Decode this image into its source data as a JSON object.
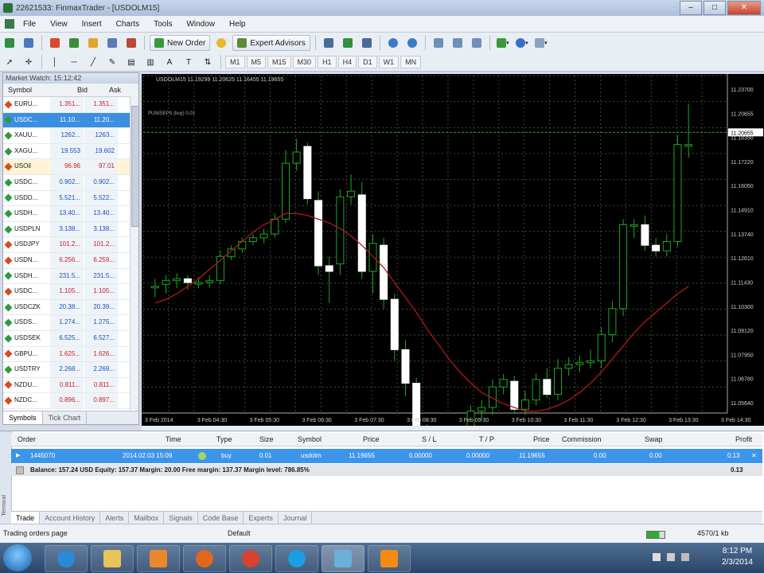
{
  "window": {
    "title": "22621533: FinmaxTrader - [USDOLM15]"
  },
  "menu": [
    "File",
    "View",
    "Insert",
    "Charts",
    "Tools",
    "Window",
    "Help"
  ],
  "toolbar": {
    "new_order": "New Order",
    "expert_advisors": "Expert Advisors",
    "timeframes": [
      "M1",
      "M5",
      "M15",
      "M30",
      "H1",
      "H4",
      "D1",
      "W1",
      "MN"
    ]
  },
  "market_watch": {
    "title": "Market Watch: 15:12:42",
    "headers": {
      "symbol": "Symbol",
      "bid": "Bid",
      "ask": "Ask"
    },
    "rows": [
      {
        "symbol": "EURU...",
        "bid": "1.351...",
        "ask": "1.351...",
        "dir": "down"
      },
      {
        "symbol": "USDC...",
        "bid": "11.10...",
        "ask": "11.20...",
        "dir": "up"
      },
      {
        "symbol": "XAUU...",
        "bid": "1262...",
        "ask": "1263...",
        "dir": "up"
      },
      {
        "symbol": "XAGU...",
        "bid": "19.553",
        "ask": "19.602",
        "dir": "up"
      },
      {
        "symbol": "USOil",
        "bid": "96.96",
        "ask": "97.01",
        "dir": "down"
      },
      {
        "symbol": "USDC...",
        "bid": "0.902...",
        "ask": "0.902...",
        "dir": "up"
      },
      {
        "symbol": "USDD...",
        "bid": "5.521...",
        "ask": "5.522...",
        "dir": "up"
      },
      {
        "symbol": "USDH...",
        "bid": "13.40...",
        "ask": "13.40...",
        "dir": "up"
      },
      {
        "symbol": "USDPLN",
        "bid": "3.138...",
        "ask": "3.138...",
        "dir": "up"
      },
      {
        "symbol": "USDJPY",
        "bid": "101.2...",
        "ask": "101.2...",
        "dir": "down"
      },
      {
        "symbol": "USDN...",
        "bid": "6.256...",
        "ask": "6.259...",
        "dir": "down"
      },
      {
        "symbol": "USDH...",
        "bid": "231.5...",
        "ask": "231.5...",
        "dir": "up"
      },
      {
        "symbol": "USDC...",
        "bid": "1.105...",
        "ask": "1.105...",
        "dir": "down"
      },
      {
        "symbol": "USDCZK",
        "bid": "20.38...",
        "ask": "20.39...",
        "dir": "up"
      },
      {
        "symbol": "USDS...",
        "bid": "1.274...",
        "ask": "1.275...",
        "dir": "up"
      },
      {
        "symbol": "USDSEK",
        "bid": "6.525...",
        "ask": "6.527...",
        "dir": "up"
      },
      {
        "symbol": "GBPU...",
        "bid": "1.625...",
        "ask": "1.626...",
        "dir": "down"
      },
      {
        "symbol": "USDTRY",
        "bid": "2.268...",
        "ask": "2.269...",
        "dir": "up"
      },
      {
        "symbol": "NZDU...",
        "bid": "0.811...",
        "ask": "0.811...",
        "dir": "down"
      },
      {
        "symbol": "NZDC...",
        "bid": "0.896...",
        "ask": "0.897...",
        "dir": "down"
      }
    ],
    "tabs": [
      "Symbols",
      "Tick Chart"
    ]
  },
  "chart": {
    "header": "USDOLM15 11.19299 11.20625 11.16455 11.19655",
    "line_label": "PUNISEPS (buy) 0.01",
    "price_labels": [
      "11.23700",
      "11.20655",
      "11.18350",
      "11.17220",
      "11.16050",
      "11.14910",
      "11.13740",
      "11.12610",
      "11.11430",
      "11.10300",
      "11.09120",
      "11.07950",
      "11.06780",
      "11.05640"
    ],
    "time_labels": [
      "3 Feb 2014",
      "3 Feb 04:30",
      "3 Feb 05:30",
      "3 Feb 06:30",
      "3 Feb 07:30",
      "3 Feb 08:30",
      "3 Feb 09:30",
      "3 Feb 10:30",
      "3 Feb 11:30",
      "3 Feb 12:30",
      "3 Feb 13:30",
      "3 Feb 14:30"
    ]
  },
  "chart_data": {
    "type": "candlestick",
    "title": "USDOLM15",
    "ylim": [
      11.056,
      11.237
    ],
    "line_level": 11.20655,
    "candles": [
      {
        "o": 11.124,
        "c": 11.124,
        "h": 11.128,
        "l": 11.118
      },
      {
        "o": 11.125,
        "c": 11.127,
        "h": 11.13,
        "l": 11.12
      },
      {
        "o": 11.127,
        "c": 11.128,
        "h": 11.131,
        "l": 11.123
      },
      {
        "o": 11.128,
        "c": 11.126,
        "h": 11.13,
        "l": 11.122
      },
      {
        "o": 11.126,
        "c": 11.126,
        "h": 11.129,
        "l": 11.123
      },
      {
        "o": 11.126,
        "c": 11.127,
        "h": 11.13,
        "l": 11.123
      },
      {
        "o": 11.127,
        "c": 11.14,
        "h": 11.143,
        "l": 11.125
      },
      {
        "o": 11.14,
        "c": 11.144,
        "h": 11.146,
        "l": 11.138
      },
      {
        "o": 11.144,
        "c": 11.148,
        "h": 11.15,
        "l": 11.142
      },
      {
        "o": 11.148,
        "c": 11.15,
        "h": 11.152,
        "l": 11.146
      },
      {
        "o": 11.15,
        "c": 11.152,
        "h": 11.155,
        "l": 11.147
      },
      {
        "o": 11.152,
        "c": 11.16,
        "h": 11.163,
        "l": 11.15
      },
      {
        "o": 11.16,
        "c": 11.19,
        "h": 11.197,
        "l": 11.158
      },
      {
        "o": 11.19,
        "c": 11.196,
        "h": 11.203,
        "l": 11.186
      },
      {
        "o": 11.199,
        "c": 11.171,
        "h": 11.201,
        "l": 11.168
      },
      {
        "o": 11.17,
        "c": 11.135,
        "h": 11.175,
        "l": 11.13
      },
      {
        "o": 11.135,
        "c": 11.132,
        "h": 11.14,
        "l": 11.115
      },
      {
        "o": 11.136,
        "c": 11.172,
        "h": 11.176,
        "l": 11.13
      },
      {
        "o": 11.172,
        "c": 11.175,
        "h": 11.184,
        "l": 11.168
      },
      {
        "o": 11.173,
        "c": 11.132,
        "h": 11.18,
        "l": 11.128
      },
      {
        "o": 11.132,
        "c": 11.147,
        "h": 11.152,
        "l": 11.12
      },
      {
        "o": 11.146,
        "c": 11.117,
        "h": 11.15,
        "l": 11.112
      },
      {
        "o": 11.117,
        "c": 11.09,
        "h": 11.12,
        "l": 11.084
      },
      {
        "o": 11.09,
        "c": 11.072,
        "h": 11.095,
        "l": 11.065
      },
      {
        "o": 11.072,
        "c": 11.048,
        "h": 11.075,
        "l": 11.04
      },
      {
        "o": 11.047,
        "c": 11.03,
        "h": 11.05,
        "l": 11.025
      },
      {
        "o": 11.03,
        "c": 11.038,
        "h": 11.046,
        "l": 11.022
      },
      {
        "o": 11.038,
        "c": 11.033,
        "h": 11.042,
        "l": 11.028
      },
      {
        "o": 11.032,
        "c": 11.027,
        "h": 11.04,
        "l": 11.018
      },
      {
        "o": 11.027,
        "c": 11.057,
        "h": 11.06,
        "l": 11.0
      },
      {
        "o": 11.057,
        "c": 11.059,
        "h": 11.063,
        "l": 11.052
      },
      {
        "o": 11.059,
        "c": 11.07,
        "h": 11.074,
        "l": 11.055
      },
      {
        "o": 11.07,
        "c": 11.074,
        "h": 11.077,
        "l": 11.066
      },
      {
        "o": 11.073,
        "c": 11.058,
        "h": 11.076,
        "l": 11.056
      },
      {
        "o": 11.058,
        "c": 11.063,
        "h": 11.068,
        "l": 11.055
      },
      {
        "o": 11.063,
        "c": 11.074,
        "h": 11.077,
        "l": 11.06
      },
      {
        "o": 11.074,
        "c": 11.066,
        "h": 11.08,
        "l": 11.064
      },
      {
        "o": 11.066,
        "c": 11.08,
        "h": 11.085,
        "l": 11.063
      },
      {
        "o": 11.08,
        "c": 11.082,
        "h": 11.086,
        "l": 11.076
      },
      {
        "o": 11.082,
        "c": 11.083,
        "h": 11.087,
        "l": 11.078
      },
      {
        "o": 11.083,
        "c": 11.084,
        "h": 11.09,
        "l": 11.08
      },
      {
        "o": 11.084,
        "c": 11.098,
        "h": 11.102,
        "l": 11.08
      },
      {
        "o": 11.098,
        "c": 11.112,
        "h": 11.116,
        "l": 11.094
      },
      {
        "o": 11.112,
        "c": 11.157,
        "h": 11.16,
        "l": 11.108
      },
      {
        "o": 11.157,
        "c": 11.157,
        "h": 11.16,
        "l": 11.15
      },
      {
        "o": 11.157,
        "c": 11.146,
        "h": 11.162,
        "l": 11.143
      },
      {
        "o": 11.146,
        "c": 11.143,
        "h": 11.15,
        "l": 11.14
      },
      {
        "o": 11.143,
        "c": 11.148,
        "h": 11.152,
        "l": 11.14
      },
      {
        "o": 11.148,
        "c": 11.2,
        "h": 11.205,
        "l": 11.145
      },
      {
        "o": 11.2,
        "c": 11.2,
        "h": 11.222,
        "l": 11.193
      }
    ],
    "ma": [
      11.115,
      11.117,
      11.12,
      11.124,
      11.128,
      11.133,
      11.138,
      11.143,
      11.148,
      11.153,
      11.157,
      11.16,
      11.163,
      11.163,
      11.162,
      11.16,
      11.158,
      11.155,
      11.151,
      11.146,
      11.14,
      11.134,
      11.126,
      11.118,
      11.11,
      11.101,
      11.093,
      11.085,
      11.078,
      11.072,
      11.067,
      11.064,
      11.061,
      11.059,
      11.057,
      11.057,
      11.058,
      11.06,
      11.063,
      11.067,
      11.072,
      11.078,
      11.085,
      11.092,
      11.099,
      11.105,
      11.11,
      11.115,
      11.12,
      11.124
    ]
  },
  "terminal": {
    "headers": [
      "Order",
      "Time",
      "Type",
      "Size",
      "Symbol",
      "Price",
      "S / L",
      "T / P",
      "Price",
      "Commission",
      "Swap",
      "Profit"
    ],
    "order": {
      "id": "1445070",
      "time": "2014.02.03 15:09",
      "type": "buy",
      "size": "0.01",
      "symbol": "usdolm",
      "price": "11.19655",
      "sl": "0.00000",
      "tp": "0.00000",
      "price2": "11.19655",
      "commission": "0.00",
      "swap": "0.00",
      "profit": "0.13"
    },
    "balance_line": "Balance: 157.24 USD  Equity: 157.37  Margin: 20.00  Free margin: 137.37  Margin level: 786.85%",
    "balance_profit": "0.13",
    "side_label": "Terminal",
    "tabs": [
      "Trade",
      "Account History",
      "Alerts",
      "Mailbox",
      "Signals",
      "Code Base",
      "Experts",
      "Journal"
    ]
  },
  "statusbar": {
    "left": "Trading orders page",
    "profile": "Default",
    "traffic": "4570/1 kb"
  },
  "taskbar": {
    "time": "8:12 PM",
    "date": "2/3/2014"
  },
  "colors": {
    "bull": "#00a000",
    "bear": "#ffffff",
    "ma": "#b01818",
    "grid": "#3c4a3c",
    "selection": "#3d95ea"
  }
}
